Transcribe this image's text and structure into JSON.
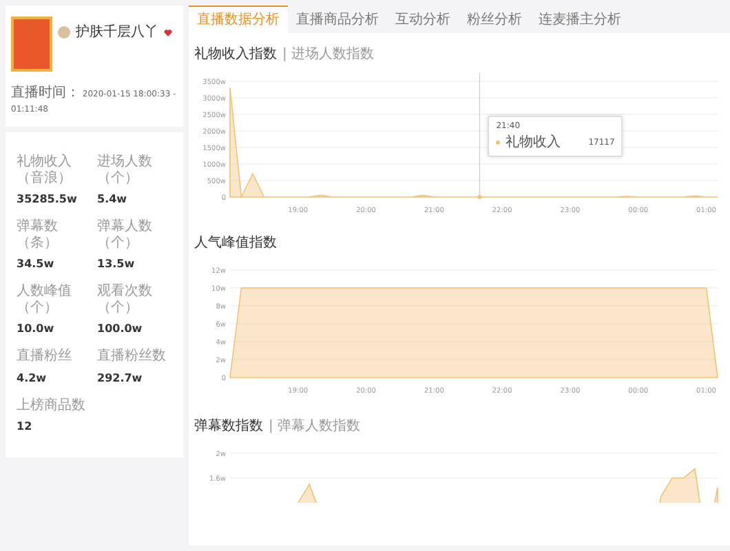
{
  "profile": {
    "name": "护肤千层八丫",
    "live_time_label": "直播时间：",
    "live_time": "2020-01-15 18:00:33 - 01:11:48"
  },
  "stats": [
    {
      "label": "礼物收入（音浪）",
      "value": "35285.5w"
    },
    {
      "label": "进场人数（个）",
      "value": "5.4w"
    },
    {
      "label": "弹幕数（条）",
      "value": "34.5w"
    },
    {
      "label": "弹幕人数（个）",
      "value": "13.5w"
    },
    {
      "label": "人数峰值（个）",
      "value": "10.0w"
    },
    {
      "label": "观看次数（个）",
      "value": "100.0w"
    },
    {
      "label": "直播粉丝",
      "value": "4.2w"
    },
    {
      "label": "直播粉丝数",
      "value": "292.7w"
    },
    {
      "label": "上榜商品数",
      "value": "12"
    }
  ],
  "tabs": [
    {
      "label": "直播数据分析",
      "selected": true
    },
    {
      "label": "直播商品分析",
      "selected": false
    },
    {
      "label": "互动分析",
      "selected": false
    },
    {
      "label": "粉丝分析",
      "selected": false
    },
    {
      "label": "连麦播主分析",
      "selected": false
    }
  ],
  "panels": [
    {
      "title": "礼物收入指数",
      "subtitle": "| 进场人数指数",
      "tooltip": {
        "time": "21:40",
        "value": "17117"
      },
      "chart_data": {
        "type": "area",
        "categories": [
          null,
          null,
          null,
          null,
          null,
          null,
          "19:00",
          null,
          null,
          null,
          null,
          null,
          "20:00",
          null,
          null,
          null,
          null,
          null,
          "21:00",
          null,
          null,
          null,
          null,
          null,
          "22:00",
          null,
          null,
          null,
          null,
          null,
          "23:00",
          null,
          null,
          null,
          null,
          null,
          "00:00",
          null,
          null,
          null,
          null,
          null,
          "01:00",
          null
        ],
        "series": [
          {
            "name": "礼物收入",
            "color": "#f2c27a",
            "values": [
              3300,
              0,
              700,
              0,
              0,
              0,
              0,
              0,
              60,
              0,
              0,
              0,
              0,
              0,
              0,
              0,
              0,
              50,
              0,
              0,
              0,
              0,
              0,
              0,
              0,
              0,
              0,
              0,
              0,
              0,
              0,
              0,
              0,
              0,
              0,
              20,
              0,
              0,
              0,
              0,
              0,
              30,
              0,
              0
            ]
          }
        ],
        "grid": true,
        "ylim": [
          0,
          3500
        ],
        "yticks": [
          {
            "value": 0,
            "label": "0"
          },
          {
            "value": 500,
            "label": "500w"
          },
          {
            "value": 1000,
            "label": "1000w"
          },
          {
            "value": 1500,
            "label": "1500w"
          },
          {
            "value": 2000,
            "label": "2000w"
          },
          {
            "value": 2500,
            "label": "2500w"
          },
          {
            "value": 3000,
            "label": "3000w"
          },
          {
            "value": 3500,
            "label": "3500w"
          }
        ]
      }
    },
    {
      "title": "人气峰值指数",
      "chart_data": {
        "type": "area",
        "categories": [
          null,
          null,
          null,
          null,
          null,
          null,
          "19:00",
          null,
          null,
          null,
          null,
          null,
          "20:00",
          null,
          null,
          null,
          null,
          null,
          "21:00",
          null,
          null,
          null,
          null,
          null,
          "22:00",
          null,
          null,
          null,
          null,
          null,
          "23:00",
          null,
          null,
          null,
          null,
          null,
          "00:00",
          null,
          null,
          null,
          null,
          null,
          "01:00",
          null
        ],
        "series": [
          {
            "color": "#f2c27a",
            "values": [
              0,
              10,
              10,
              10,
              10,
              10,
              10,
              10,
              10,
              10,
              10,
              10,
              10,
              10,
              10,
              10,
              10,
              10,
              10,
              10,
              10,
              10,
              10,
              10,
              10,
              10,
              10,
              10,
              10,
              10,
              10,
              10,
              10,
              10,
              10,
              10,
              10,
              10,
              10,
              10,
              10,
              10,
              10,
              0
            ]
          }
        ],
        "grid": true,
        "ylim": [
          0,
          12
        ],
        "yticks": [
          {
            "value": 0,
            "label": "0"
          },
          {
            "value": 2,
            "label": "2w"
          },
          {
            "value": 4,
            "label": "4w"
          },
          {
            "value": 6,
            "label": "6w"
          },
          {
            "value": 8,
            "label": "8w"
          },
          {
            "value": 10,
            "label": "10w"
          },
          {
            "value": 12,
            "label": "12w"
          }
        ]
      }
    },
    {
      "title": "弹幕数指数",
      "subtitle": "| 弹幕人数指数",
      "chart_data": {
        "type": "area",
        "grid": true,
        "series": [
          {
            "color": "#f2c27a",
            "values": [
              0,
              0,
              0,
              0,
              0,
              0,
              1.2,
              1.5,
              1.0,
              0,
              0,
              0,
              0,
              0,
              0,
              0,
              0,
              0,
              0,
              0,
              0,
              0,
              0,
              0,
              0,
              0,
              0,
              0,
              0,
              0,
              0,
              0,
              0,
              0,
              0,
              0,
              0,
              0,
              1.3,
              1.6,
              1.6,
              1.75,
              0.5,
              1.45
            ]
          }
        ],
        "ylim": [
          0,
          2
        ],
        "yticks": [
          {
            "value": 1.6,
            "label": "1.6w"
          },
          {
            "value": 2,
            "label": "2w"
          }
        ]
      }
    }
  ]
}
